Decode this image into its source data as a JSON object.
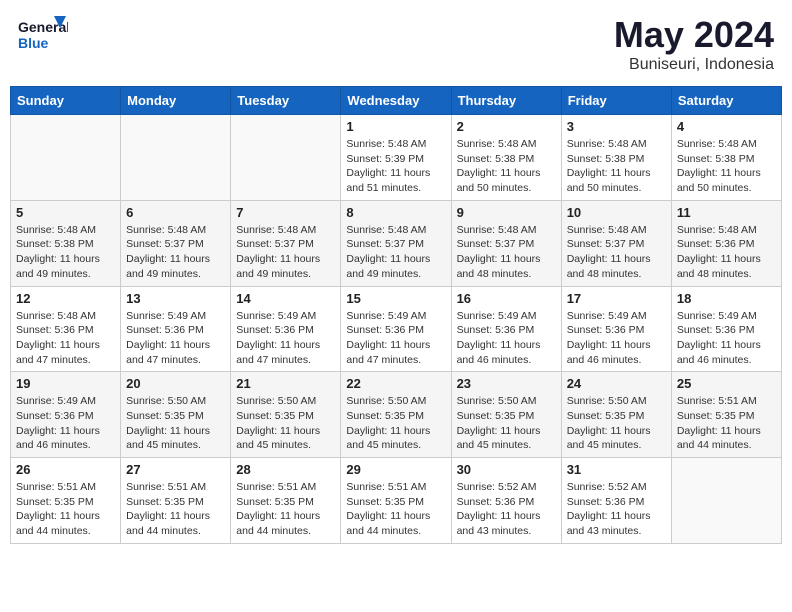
{
  "header": {
    "logo_general": "General",
    "logo_blue": "Blue",
    "month_title": "May 2024",
    "location": "Buniseuri, Indonesia"
  },
  "calendar": {
    "days_of_week": [
      "Sunday",
      "Monday",
      "Tuesday",
      "Wednesday",
      "Thursday",
      "Friday",
      "Saturday"
    ],
    "weeks": [
      [
        {
          "day": "",
          "info": ""
        },
        {
          "day": "",
          "info": ""
        },
        {
          "day": "",
          "info": ""
        },
        {
          "day": "1",
          "info": "Sunrise: 5:48 AM\nSunset: 5:39 PM\nDaylight: 11 hours\nand 51 minutes."
        },
        {
          "day": "2",
          "info": "Sunrise: 5:48 AM\nSunset: 5:38 PM\nDaylight: 11 hours\nand 50 minutes."
        },
        {
          "day": "3",
          "info": "Sunrise: 5:48 AM\nSunset: 5:38 PM\nDaylight: 11 hours\nand 50 minutes."
        },
        {
          "day": "4",
          "info": "Sunrise: 5:48 AM\nSunset: 5:38 PM\nDaylight: 11 hours\nand 50 minutes."
        }
      ],
      [
        {
          "day": "5",
          "info": "Sunrise: 5:48 AM\nSunset: 5:38 PM\nDaylight: 11 hours\nand 49 minutes."
        },
        {
          "day": "6",
          "info": "Sunrise: 5:48 AM\nSunset: 5:37 PM\nDaylight: 11 hours\nand 49 minutes."
        },
        {
          "day": "7",
          "info": "Sunrise: 5:48 AM\nSunset: 5:37 PM\nDaylight: 11 hours\nand 49 minutes."
        },
        {
          "day": "8",
          "info": "Sunrise: 5:48 AM\nSunset: 5:37 PM\nDaylight: 11 hours\nand 49 minutes."
        },
        {
          "day": "9",
          "info": "Sunrise: 5:48 AM\nSunset: 5:37 PM\nDaylight: 11 hours\nand 48 minutes."
        },
        {
          "day": "10",
          "info": "Sunrise: 5:48 AM\nSunset: 5:37 PM\nDaylight: 11 hours\nand 48 minutes."
        },
        {
          "day": "11",
          "info": "Sunrise: 5:48 AM\nSunset: 5:36 PM\nDaylight: 11 hours\nand 48 minutes."
        }
      ],
      [
        {
          "day": "12",
          "info": "Sunrise: 5:48 AM\nSunset: 5:36 PM\nDaylight: 11 hours\nand 47 minutes."
        },
        {
          "day": "13",
          "info": "Sunrise: 5:49 AM\nSunset: 5:36 PM\nDaylight: 11 hours\nand 47 minutes."
        },
        {
          "day": "14",
          "info": "Sunrise: 5:49 AM\nSunset: 5:36 PM\nDaylight: 11 hours\nand 47 minutes."
        },
        {
          "day": "15",
          "info": "Sunrise: 5:49 AM\nSunset: 5:36 PM\nDaylight: 11 hours\nand 47 minutes."
        },
        {
          "day": "16",
          "info": "Sunrise: 5:49 AM\nSunset: 5:36 PM\nDaylight: 11 hours\nand 46 minutes."
        },
        {
          "day": "17",
          "info": "Sunrise: 5:49 AM\nSunset: 5:36 PM\nDaylight: 11 hours\nand 46 minutes."
        },
        {
          "day": "18",
          "info": "Sunrise: 5:49 AM\nSunset: 5:36 PM\nDaylight: 11 hours\nand 46 minutes."
        }
      ],
      [
        {
          "day": "19",
          "info": "Sunrise: 5:49 AM\nSunset: 5:36 PM\nDaylight: 11 hours\nand 46 minutes."
        },
        {
          "day": "20",
          "info": "Sunrise: 5:50 AM\nSunset: 5:35 PM\nDaylight: 11 hours\nand 45 minutes."
        },
        {
          "day": "21",
          "info": "Sunrise: 5:50 AM\nSunset: 5:35 PM\nDaylight: 11 hours\nand 45 minutes."
        },
        {
          "day": "22",
          "info": "Sunrise: 5:50 AM\nSunset: 5:35 PM\nDaylight: 11 hours\nand 45 minutes."
        },
        {
          "day": "23",
          "info": "Sunrise: 5:50 AM\nSunset: 5:35 PM\nDaylight: 11 hours\nand 45 minutes."
        },
        {
          "day": "24",
          "info": "Sunrise: 5:50 AM\nSunset: 5:35 PM\nDaylight: 11 hours\nand 45 minutes."
        },
        {
          "day": "25",
          "info": "Sunrise: 5:51 AM\nSunset: 5:35 PM\nDaylight: 11 hours\nand 44 minutes."
        }
      ],
      [
        {
          "day": "26",
          "info": "Sunrise: 5:51 AM\nSunset: 5:35 PM\nDaylight: 11 hours\nand 44 minutes."
        },
        {
          "day": "27",
          "info": "Sunrise: 5:51 AM\nSunset: 5:35 PM\nDaylight: 11 hours\nand 44 minutes."
        },
        {
          "day": "28",
          "info": "Sunrise: 5:51 AM\nSunset: 5:35 PM\nDaylight: 11 hours\nand 44 minutes."
        },
        {
          "day": "29",
          "info": "Sunrise: 5:51 AM\nSunset: 5:35 PM\nDaylight: 11 hours\nand 44 minutes."
        },
        {
          "day": "30",
          "info": "Sunrise: 5:52 AM\nSunset: 5:36 PM\nDaylight: 11 hours\nand 43 minutes."
        },
        {
          "day": "31",
          "info": "Sunrise: 5:52 AM\nSunset: 5:36 PM\nDaylight: 11 hours\nand 43 minutes."
        },
        {
          "day": "",
          "info": ""
        }
      ]
    ]
  }
}
